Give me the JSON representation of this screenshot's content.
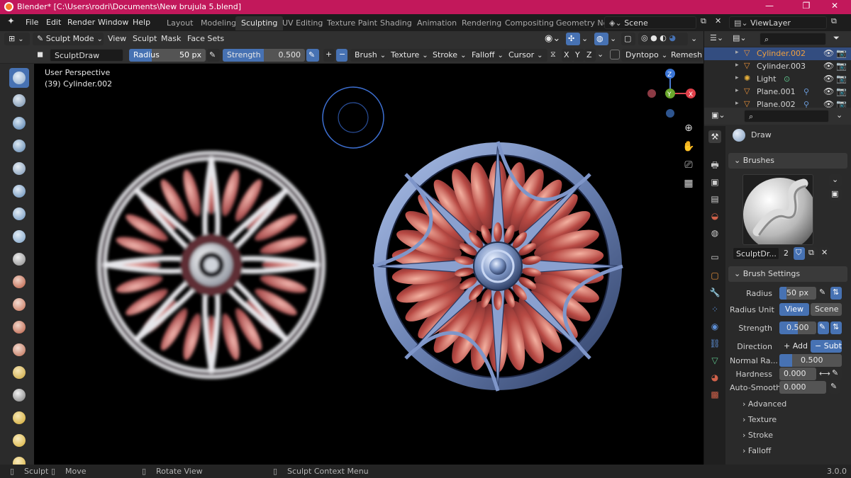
{
  "titlebar": {
    "title": "Blender* [C:\\Users\\rodri\\Documents\\New brujula 5.blend]",
    "minimize": "—",
    "maximize": "❐",
    "close": "✕"
  },
  "menu": {
    "file": "File",
    "edit": "Edit",
    "render": "Render",
    "window": "Window",
    "help": "Help"
  },
  "workspaces": [
    "Layout",
    "Modeling",
    "Sculpting",
    "UV Editing",
    "Texture Paint",
    "Shading",
    "Animation",
    "Rendering",
    "Compositing",
    "Geometry No"
  ],
  "active_workspace": "Sculpting",
  "scene": {
    "name": "Scene",
    "view_layer": "ViewLayer"
  },
  "header": {
    "mode": "Sculpt Mode",
    "view": "View",
    "sculpt": "Sculpt",
    "mask": "Mask",
    "face_sets": "Face Sets"
  },
  "toolheader": {
    "brush_name": "SculptDraw",
    "radius_label": "Radius",
    "radius_value": "50 px",
    "strength_label": "Strength",
    "strength_value": "0.500",
    "brush": "Brush",
    "texture": "Texture",
    "stroke": "Stroke",
    "falloff": "Falloff",
    "cursor": "Cursor",
    "axis_x": "X",
    "axis_y": "Y",
    "axis_z": "Z",
    "dyntopo": "Dyntopo",
    "remesh": "Remesh"
  },
  "viewport": {
    "perspective": "User Perspective",
    "object_info": "(39) Cylinder.002",
    "axis_x": "X",
    "axis_y": "Y",
    "axis_z": "Z"
  },
  "outliner": {
    "items": [
      {
        "name": "Cylinder.002",
        "selected": true,
        "icon": "mesh-icon"
      },
      {
        "name": "Cylinder.003",
        "selected": false,
        "icon": "mesh-icon"
      },
      {
        "name": "Light",
        "selected": false,
        "icon": "light-icon"
      },
      {
        "name": "Plane.001",
        "selected": false,
        "icon": "mesh-icon"
      },
      {
        "name": "Plane.002",
        "selected": false,
        "icon": "mesh-icon"
      }
    ]
  },
  "properties": {
    "tool_name": "Draw",
    "brushes_panel": "Brushes",
    "brush_datablock": "SculptDr...",
    "brush_users": "2",
    "brush_settings_panel": "Brush Settings",
    "radius_label": "Radius",
    "radius_value": "50 px",
    "radius_unit_label": "Radius Unit",
    "radius_unit_view": "View",
    "radius_unit_scene": "Scene",
    "strength_label": "Strength",
    "strength_value": "0.500",
    "direction_label": "Direction",
    "direction_add": "+ Add",
    "direction_subtract": "− Subt...",
    "normal_radius_label": "Normal Ra...",
    "normal_radius_value": "0.500",
    "hardness_label": "Hardness",
    "hardness_value": "0.000",
    "auto_smooth_label": "Auto-Smooth",
    "auto_smooth_value": "0.000",
    "subpanels": [
      "Advanced",
      "Texture",
      "Stroke",
      "Falloff"
    ]
  },
  "statusbar": {
    "sculpt": "Sculpt",
    "move": "Move",
    "rotate": "Rotate View",
    "context": "Sculpt Context Menu",
    "version": "3.0.0"
  },
  "colors": {
    "accent": "#4772b3",
    "titlebar": "#c2185b",
    "petal": "#b24a44",
    "frame": "#6f86b8"
  }
}
